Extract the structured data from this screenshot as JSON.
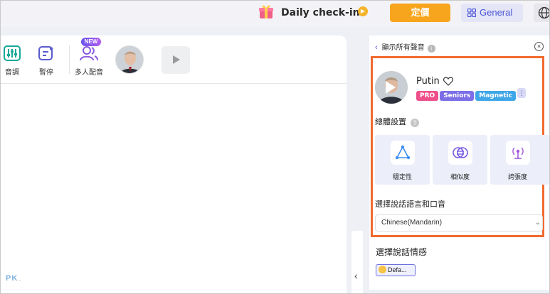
{
  "topbar": {
    "checkin_label": "Daily check-in",
    "pricing_label": "定價",
    "general_label": "General"
  },
  "toolbar": {
    "pitch_label": "音調",
    "pause_label": "暫停",
    "multi_label": "多人配音",
    "new_badge": "NEW"
  },
  "watermark": {
    "text": "PK",
    "sub": "..."
  },
  "voice_panel": {
    "show_all_label": "顯示所有聲音",
    "voice_name": "Putin",
    "tags": [
      "PRO",
      "Seniors",
      "Magnetic"
    ],
    "more_tag": "⋮",
    "overall_settings_label": "總體設置",
    "settings": [
      {
        "label": "穩定性",
        "icon": "stability-icon"
      },
      {
        "label": "相似度",
        "icon": "similarity-icon"
      },
      {
        "label": "誇張度",
        "icon": "exaggeration-icon"
      }
    ],
    "language_label": "選擇說話語言和口音",
    "language_value": "Chinese(Mandarin)",
    "emotion_label": "選擇說話情感",
    "emotion_value": "Defa..."
  },
  "colors": {
    "accent": "#4b55d9",
    "pricing": "#f7a51c",
    "highlight": "#f26a2e",
    "tag_pro": "#ee4f8a",
    "tag_seniors": "#7b6ee6",
    "tag_magnetic": "#3fa6e8"
  }
}
